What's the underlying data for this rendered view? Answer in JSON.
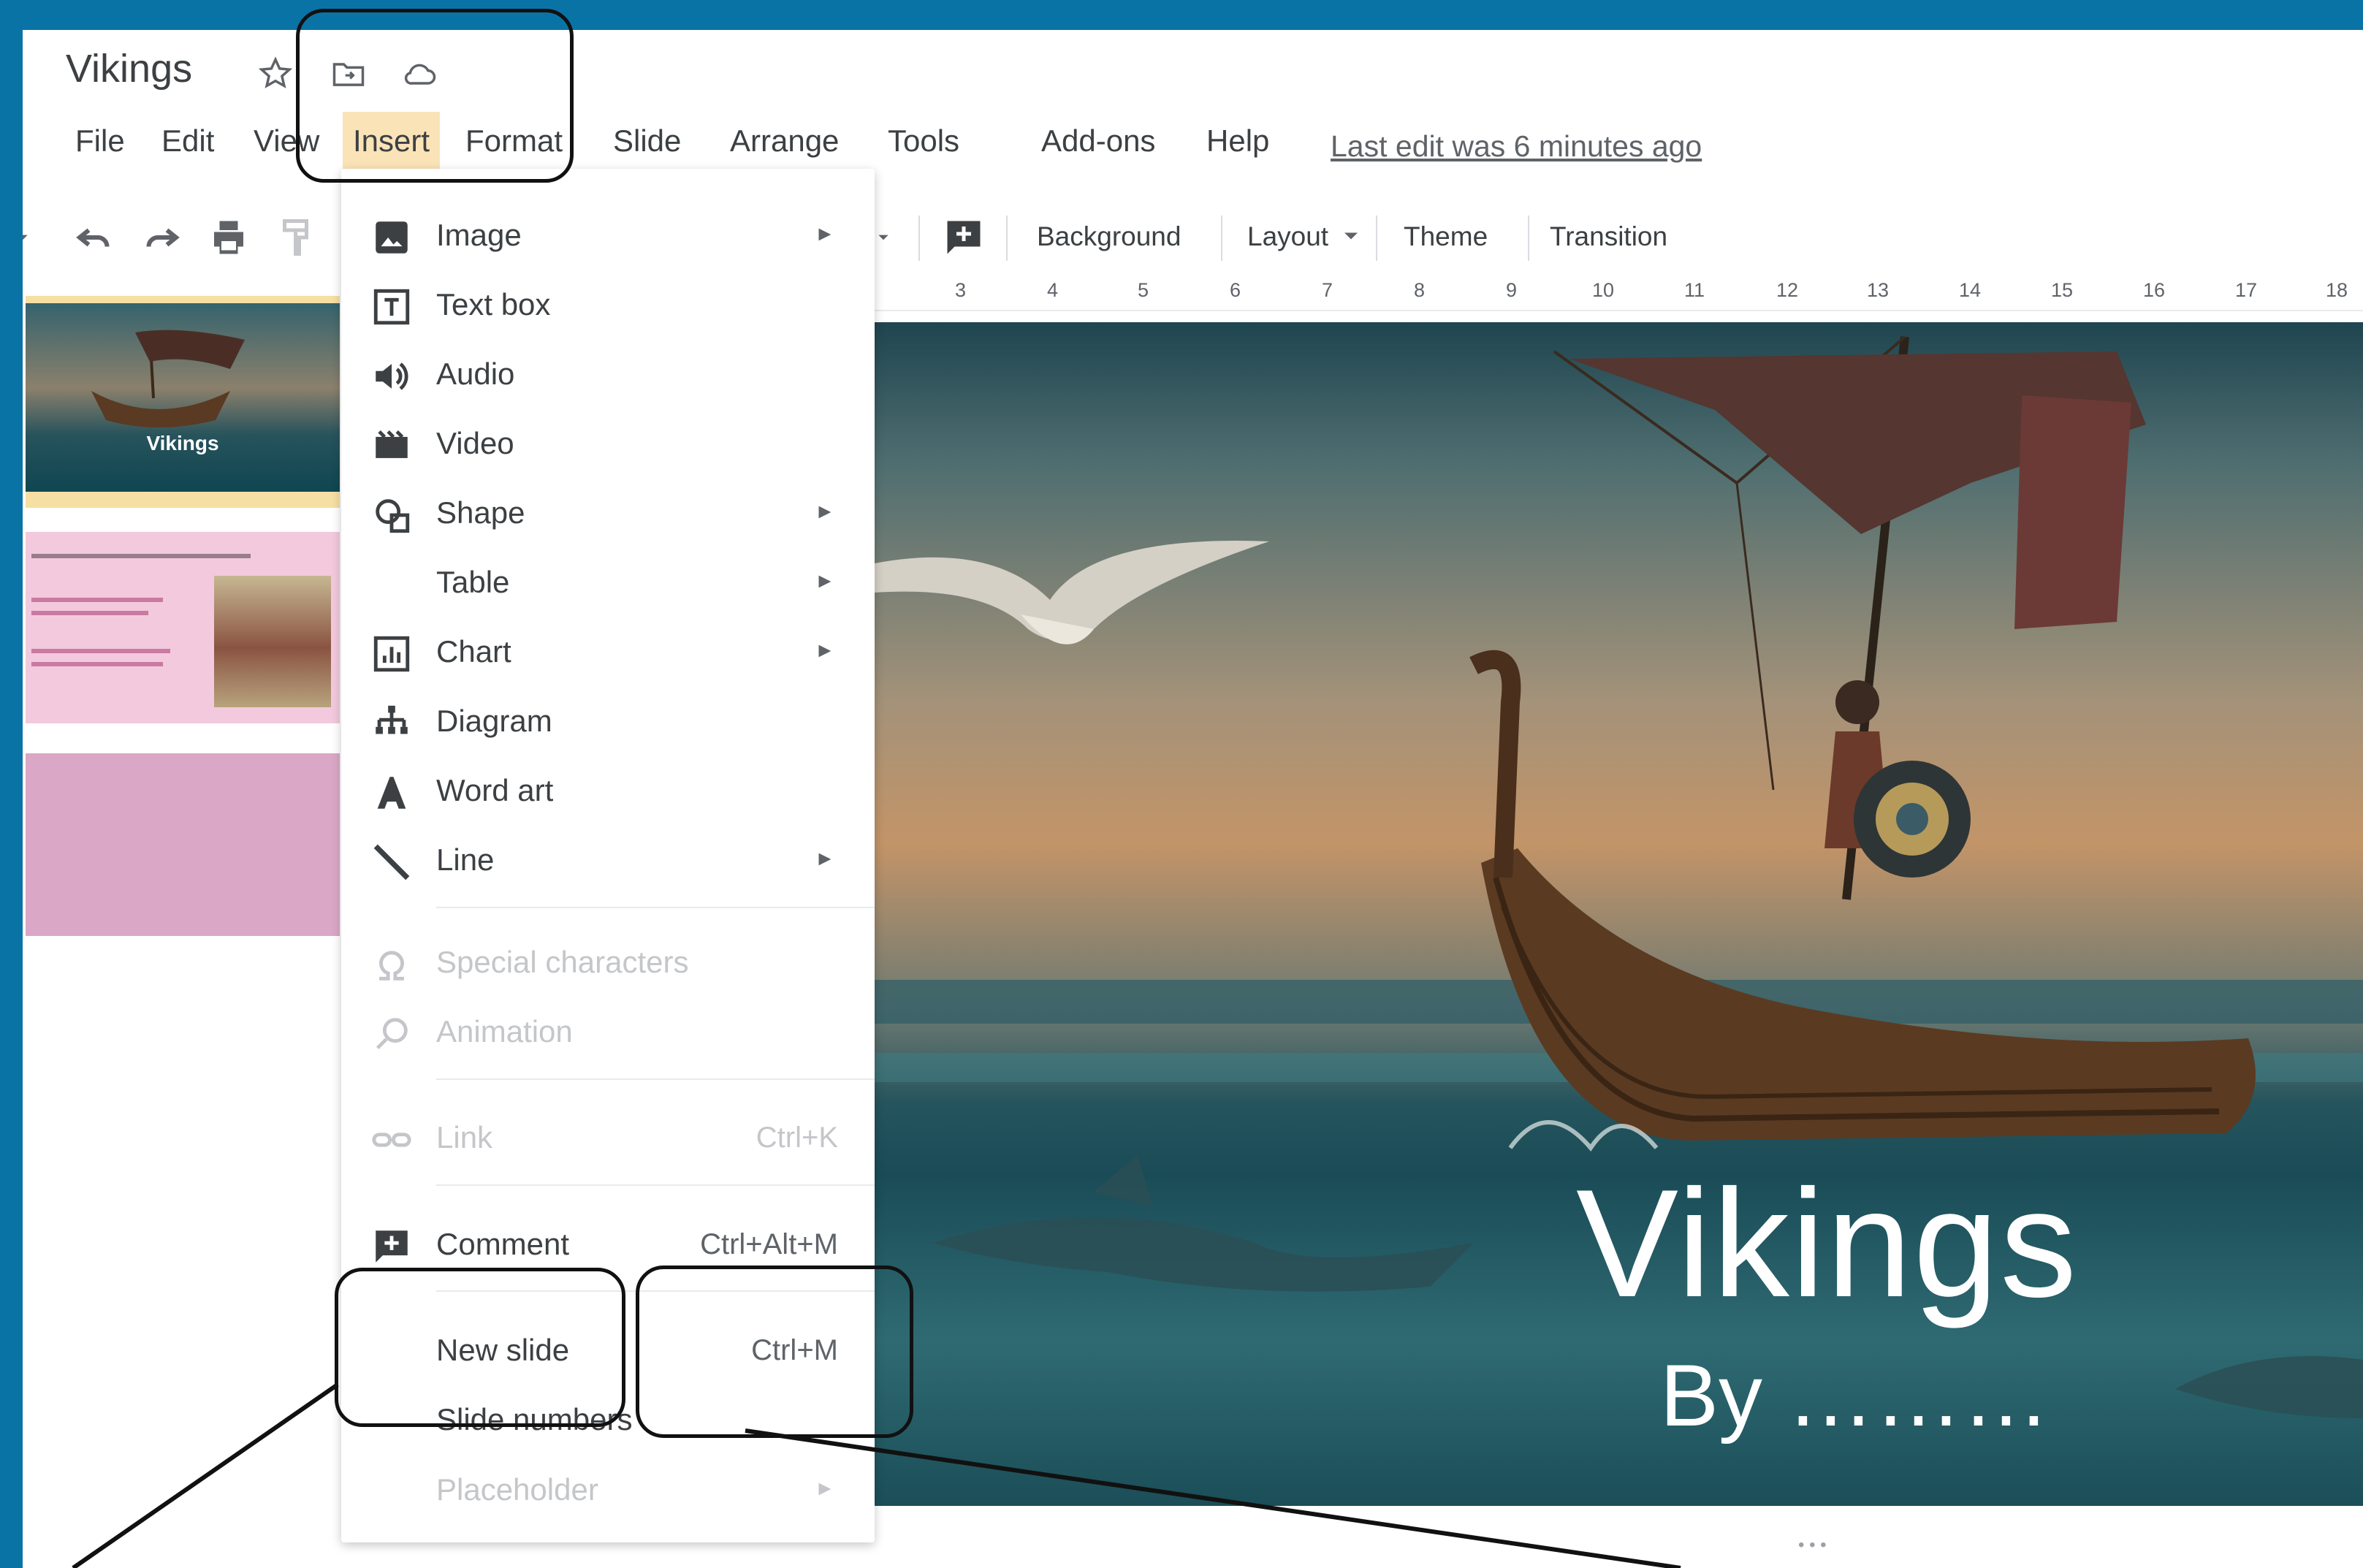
{
  "doc": {
    "title": "Vikings"
  },
  "menubar": {
    "items": [
      "File",
      "Edit",
      "View",
      "Insert",
      "Format",
      "Slide",
      "Arrange",
      "Tools",
      "Add-ons",
      "Help"
    ],
    "last_edit": "Last edit was 6 minutes ago"
  },
  "toolbar": {
    "background": "Background",
    "layout": "Layout",
    "theme": "Theme",
    "transition": "Transition"
  },
  "ruler": [
    "3",
    "4",
    "5",
    "6",
    "7",
    "8",
    "9",
    "10",
    "11",
    "12",
    "13",
    "14",
    "15",
    "16",
    "17",
    "18"
  ],
  "filmstrip": {
    "slide1_title": "Vikings"
  },
  "insert_menu": {
    "items": [
      {
        "label": "Image",
        "icon": "image-icon",
        "submenu": true
      },
      {
        "label": "Text box",
        "icon": "text-box-icon"
      },
      {
        "label": "Audio",
        "icon": "audio-icon"
      },
      {
        "label": "Video",
        "icon": "video-icon"
      },
      {
        "label": "Shape",
        "icon": "shape-icon",
        "submenu": true
      },
      {
        "label": "Table",
        "submenu": true
      },
      {
        "label": "Chart",
        "icon": "chart-icon",
        "submenu": true
      },
      {
        "label": "Diagram",
        "icon": "diagram-icon"
      },
      {
        "label": "Word art",
        "icon": "word-art-icon"
      },
      {
        "label": "Line",
        "icon": "line-icon",
        "submenu": true
      },
      {
        "label": "Special characters",
        "icon": "omega-icon",
        "disabled": true
      },
      {
        "label": "Animation",
        "icon": "animation-icon",
        "disabled": true
      },
      {
        "label": "Link",
        "icon": "link-icon",
        "shortcut": "Ctrl+K",
        "disabled": true
      },
      {
        "label": "Comment",
        "icon": "comment-icon",
        "shortcut": "Ctrl+Alt+M"
      },
      {
        "label": "New slide",
        "shortcut": "Ctrl+M"
      },
      {
        "label": "Slide numbers"
      },
      {
        "label": "Placeholder",
        "submenu": true,
        "disabled": true
      }
    ]
  },
  "slide": {
    "title": "Vikings",
    "subtitle": "By ………"
  },
  "colors": {
    "frame": "#0a73a6",
    "insert_highlight": "#fbe3b8",
    "thumb1_border": "#f6dfa3",
    "thumb2_bg": "#f3c9dd",
    "thumb3_bg": "#daa8c6"
  }
}
